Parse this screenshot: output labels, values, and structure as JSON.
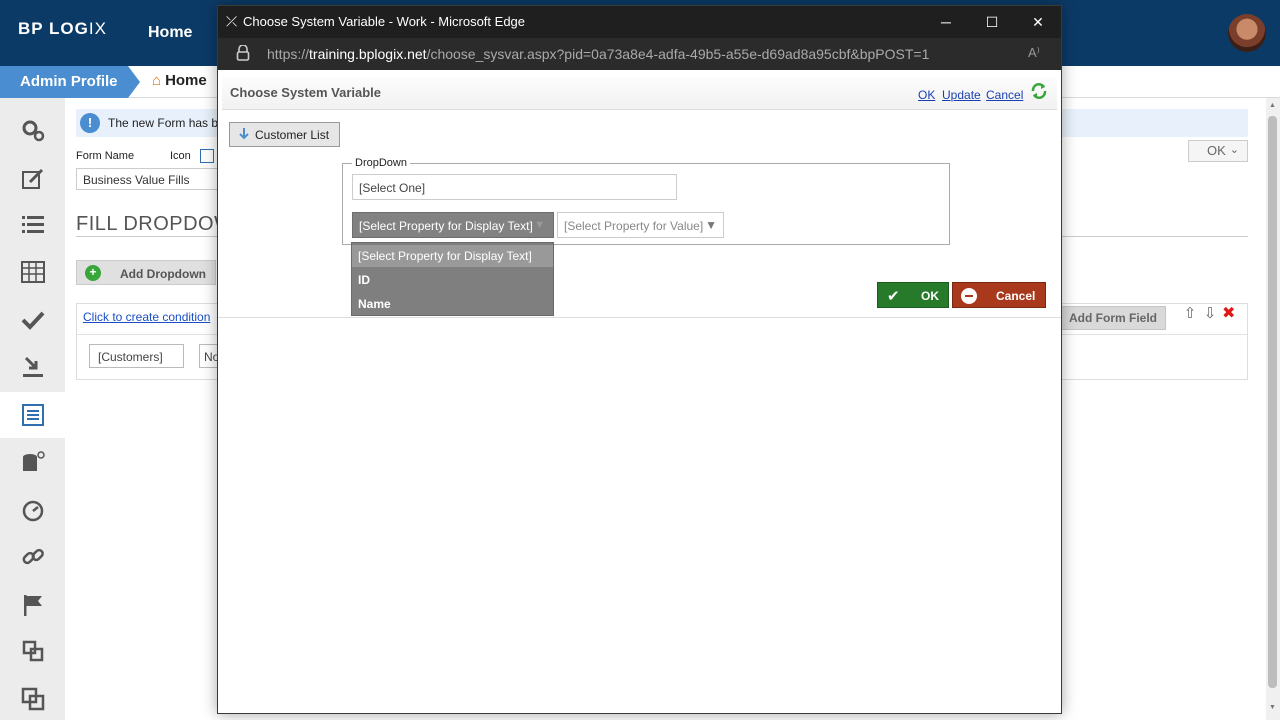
{
  "app": {
    "logo_main": "BP LOG",
    "logo_tail": "IX",
    "top_nav_home": "Home",
    "breadcrumb_admin": "Admin Profile",
    "breadcrumb_home": "Home"
  },
  "sidebar": {
    "items": [
      {
        "icon": "gears-icon"
      },
      {
        "icon": "edit-icon"
      },
      {
        "icon": "list-icon"
      },
      {
        "icon": "table-icon"
      },
      {
        "icon": "check-icon"
      },
      {
        "icon": "download-icon"
      },
      {
        "icon": "form-icon",
        "active": true
      },
      {
        "icon": "database-icon"
      },
      {
        "icon": "timer-icon"
      },
      {
        "icon": "link-icon"
      },
      {
        "icon": "flag-icon"
      },
      {
        "icon": "copy-icon"
      },
      {
        "icon": "layers-icon"
      }
    ]
  },
  "content": {
    "notice_text": "The new Form has b",
    "form_name_label": "Form Name",
    "icon_label": "Icon",
    "form_name_value": "Business Value Fills",
    "section_title": "FILL DROPDOW",
    "add_dropdown_label": "Add Dropdown",
    "condition_link": "Click to create condition",
    "customers_field": "[Customers]",
    "second_field": "No",
    "add_form_field_label": "Add Form Field",
    "ok_dropdown": "OK"
  },
  "popup": {
    "window_title": "Choose System Variable - Work - Microsoft Edge",
    "url_prefix": "https://",
    "url_host": "training.bplogix.net",
    "url_path": "/choose_sysvar.aspx?pid=0a73a8e4-adfa-49b5-a55e-d69ad8a95cbf&bpPOST=1",
    "dialog_title": "Choose System Variable",
    "link_ok": "OK",
    "link_update": "Update",
    "link_cancel": "Cancel",
    "customer_list_button": "Customer List",
    "fieldset_legend": "DropDown",
    "select_one": "[Select One]",
    "display_select": "[Select Property for Display Text]",
    "value_select": "[Select Property for Value]",
    "dropdown_options": [
      "[Select Property for Display Text]",
      "ID",
      "Name"
    ],
    "ok_button": "OK",
    "cancel_button": "Cancel"
  },
  "colors": {
    "topbar": "#0c3a66",
    "accent_blue": "#4a8ed1",
    "ok_green": "#267a2a",
    "cancel_red": "#a8391d"
  }
}
